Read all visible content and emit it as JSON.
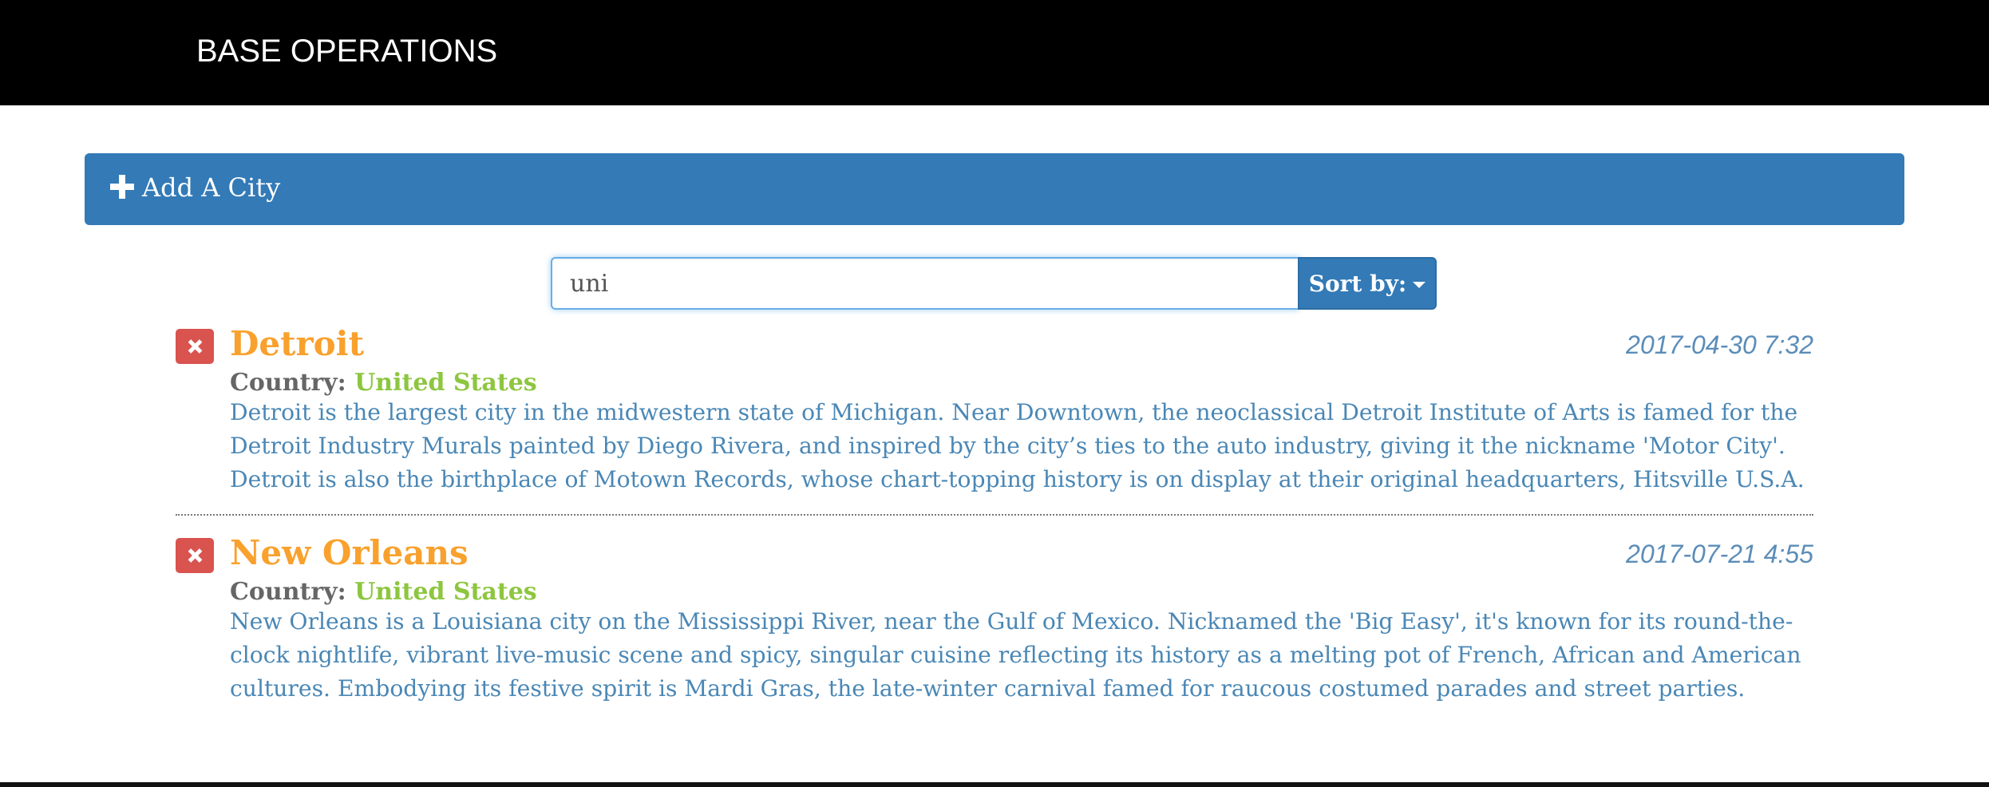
{
  "navbar": {
    "brand": "BASE OPERATIONS"
  },
  "add_panel": {
    "label": "Add A City",
    "icon": "plus-icon"
  },
  "search": {
    "value": "uni",
    "sort_label": "Sort by:",
    "sort_icon": "caret-down-icon"
  },
  "colors": {
    "navbar": "#000000",
    "primary": "#337ab7",
    "danger": "#d9534f",
    "city_name": "#f9a12d",
    "country_value": "#8dc63f",
    "description": "#4a87b5",
    "timestamp": "#5b8db8"
  },
  "cities": [
    {
      "name": "Detroit",
      "timestamp": "2017-04-30 7:32",
      "country_label": "Country:",
      "country": "United States",
      "description": "Detroit is the largest city in the midwestern state of Michigan. Near Downtown, the neoclassical Detroit Institute of Arts is famed for the Detroit Industry Murals painted by Diego Rivera, and inspired by the city’s ties to the auto industry, giving it the nickname 'Motor City'. Detroit is also the birthplace of Motown Records, whose chart-topping history is on display at their original headquarters, Hitsville U.S.A.",
      "delete_icon": "close-icon"
    },
    {
      "name": "New Orleans",
      "timestamp": "2017-07-21 4:55",
      "country_label": "Country:",
      "country": "United States",
      "description": "New Orleans is a Louisiana city on the Mississippi River, near the Gulf of Mexico. Nicknamed the 'Big Easy', it's known for its round-the-clock nightlife, vibrant live-music scene and spicy, singular cuisine reflecting its history as a melting pot of French, African and American cultures. Embodying its festive spirit is Mardi Gras, the late-winter carnival famed for raucous costumed parades and street parties.",
      "delete_icon": "close-icon"
    }
  ]
}
